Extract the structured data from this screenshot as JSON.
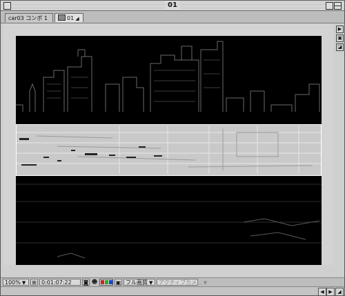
{
  "window": {
    "title": "01"
  },
  "tabs": [
    {
      "label": "car03 コンポ 1"
    },
    {
      "label": "01",
      "flag": "◢"
    }
  ],
  "side_icons": [
    "▶",
    "▣",
    "◪"
  ],
  "status": {
    "zoom": "100%",
    "zoom_arrow": "▼",
    "timecode": "0:01:07:22",
    "quality": "フル画質",
    "quality_arrow": "▼",
    "camera": "アクティブカメ...",
    "camera_arrow": "▼"
  },
  "colors": {
    "channel_red": "#d02020",
    "channel_green": "#20b030",
    "channel_blue": "#2040d0"
  },
  "icons": {
    "resolution": "resolution-icon",
    "snapshot": "camera-icon",
    "person": "person-icon",
    "channels": "channels-icon",
    "region": "region-icon"
  }
}
